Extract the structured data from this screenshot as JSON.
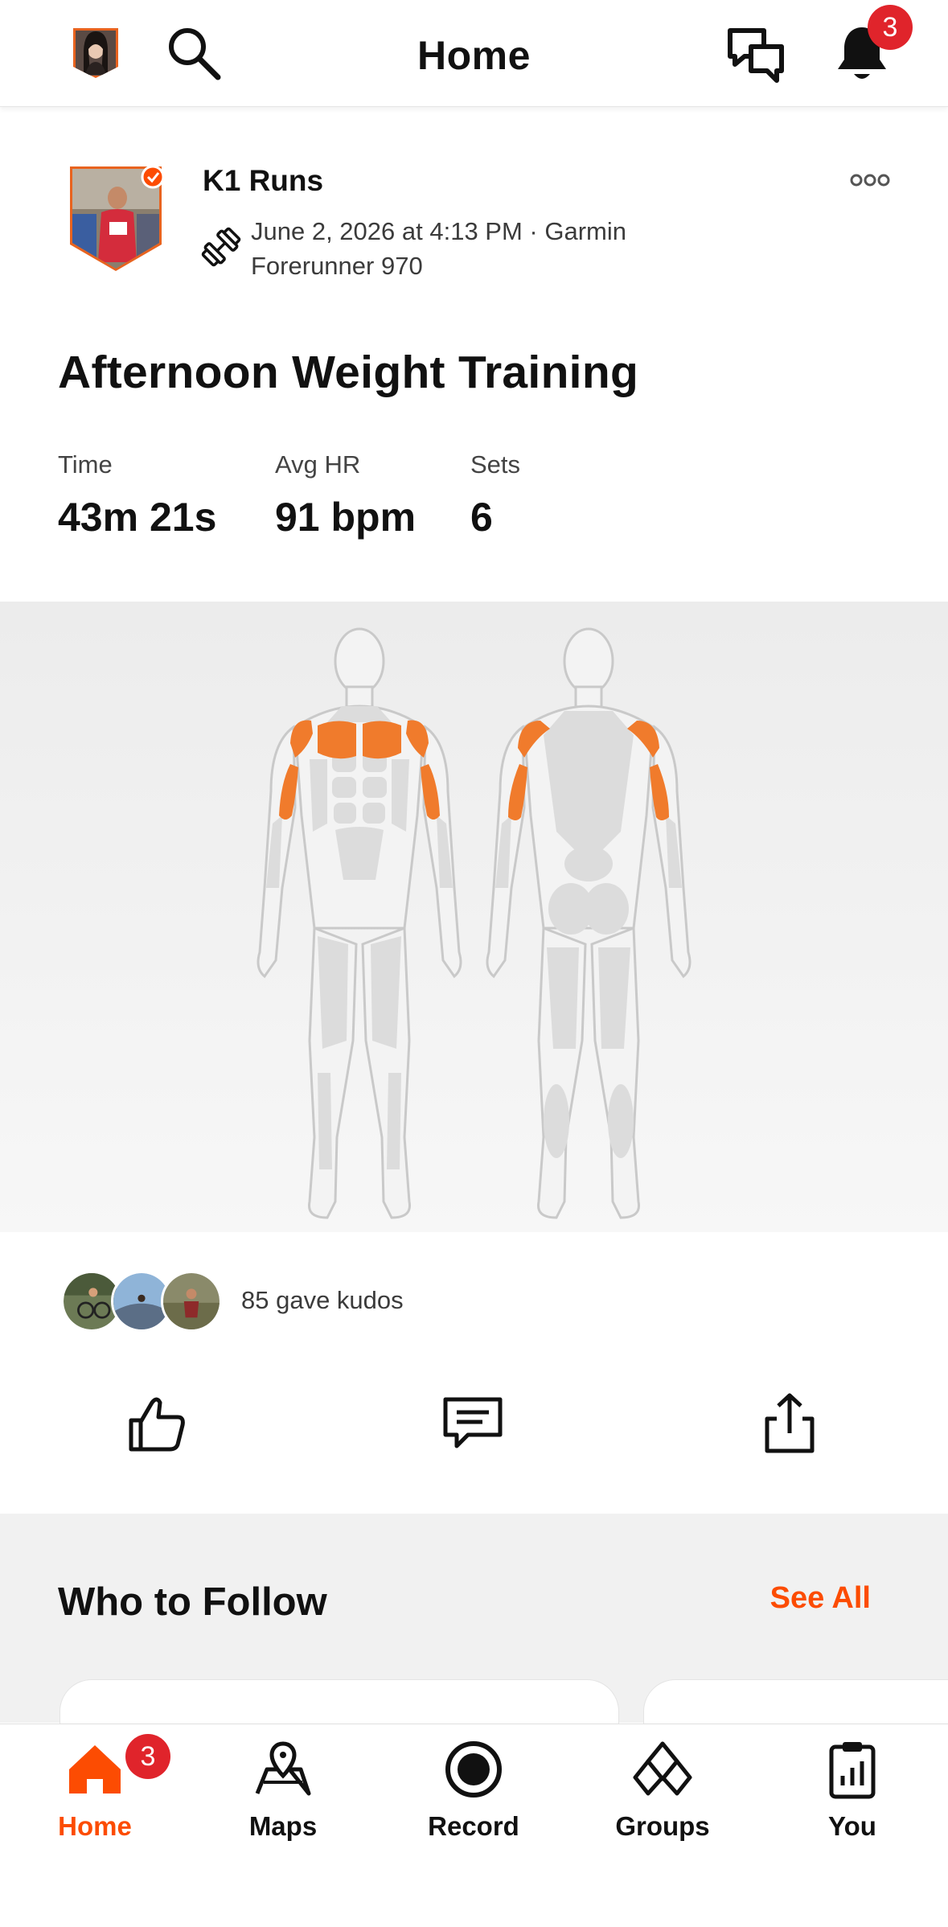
{
  "header": {
    "title": "Home",
    "notification_count": "3",
    "icons": [
      "avatar",
      "search-icon",
      "chat-icon",
      "bell-icon"
    ]
  },
  "activity": {
    "athlete_name": "K1 Runs",
    "meta": "June 2, 2026 at 4:13 PM · Garmin Forerunner 970",
    "title": "Afternoon Weight Training",
    "stats": [
      {
        "label": "Time",
        "value": "43m 21s"
      },
      {
        "label": "Avg HR",
        "value": "91 bpm"
      },
      {
        "label": "Sets",
        "value": "6"
      }
    ],
    "kudos_text": "85 gave kudos",
    "actions": [
      "like-icon",
      "comment-icon",
      "share-icon"
    ],
    "highlighted_muscles": [
      "chest",
      "front-shoulders",
      "biceps",
      "rear-shoulders",
      "triceps"
    ]
  },
  "who_to_follow": {
    "title": "Who to Follow",
    "see_all": "See All"
  },
  "bottom_nav": {
    "home": "Home",
    "home_badge": "3",
    "maps": "Maps",
    "record": "Record",
    "groups": "Groups",
    "you": "You"
  },
  "colors": {
    "accent": "#fc4c02",
    "muscle_highlight": "#f07b2c",
    "badge": "#e0242b",
    "muscle_base": "#dcdcdc"
  }
}
